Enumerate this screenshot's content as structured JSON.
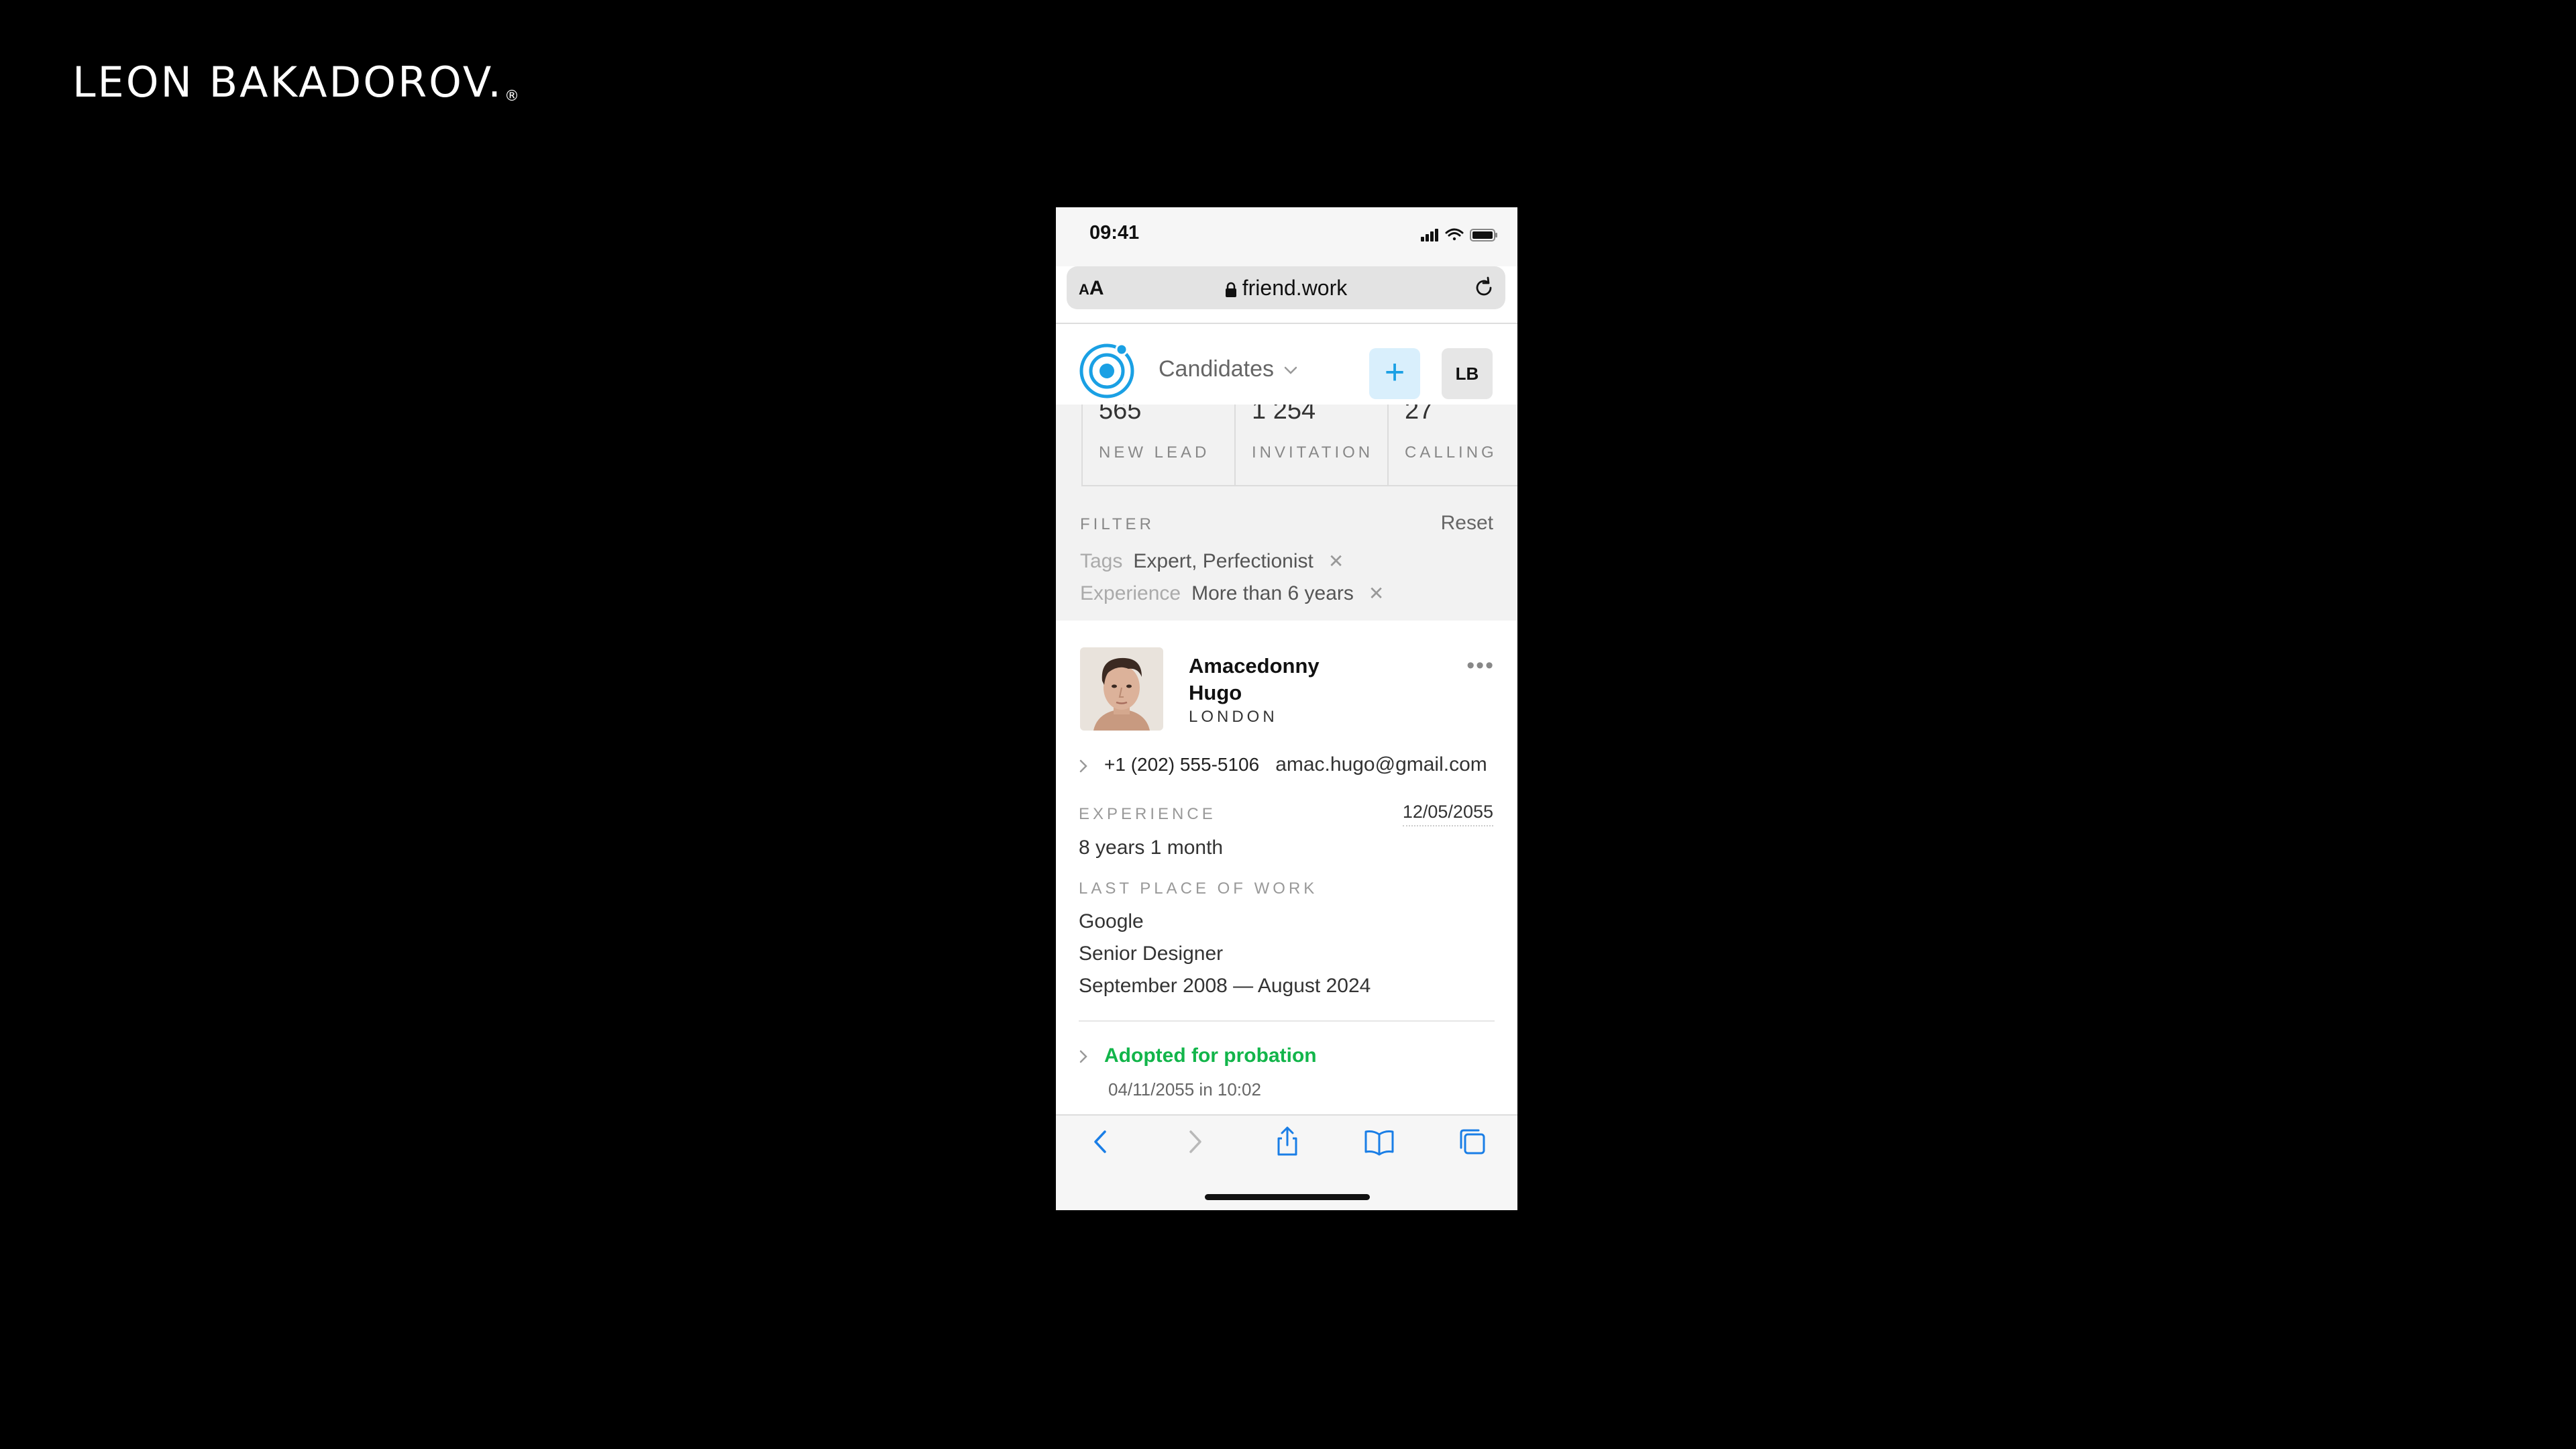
{
  "brand": {
    "name": "LEON BAKADOROV.",
    "mark": "®"
  },
  "status_bar": {
    "time": "09:41"
  },
  "browser": {
    "text_size": "AA",
    "url": "friend.work"
  },
  "app": {
    "section": "Candidates",
    "add_label": "+",
    "user_initials": "LB"
  },
  "stats": [
    {
      "value": "565",
      "label": "NEW LEAD"
    },
    {
      "value": "1 254",
      "label": "INVITATION"
    },
    {
      "value": "27",
      "label": "CALLING"
    }
  ],
  "filter": {
    "title": "FILTER",
    "reset": "Reset",
    "rows": [
      {
        "key": "Tags",
        "value": "Expert, Perfectionist",
        "remove": "✕"
      },
      {
        "key": "Experience",
        "value": "More than 6 years",
        "remove": "✕"
      }
    ]
  },
  "candidate": {
    "first_name": "Amacedonny",
    "last_name": "Hugo",
    "city": "LONDON",
    "more": "•••",
    "phone": "+1 (202) 555-5106",
    "email": "amac.hugo@gmail.com",
    "experience_label": "EXPERIENCE",
    "experience_value": "8 years 1 month",
    "experience_date": "12/05/2055",
    "last_work_label": "LAST PLACE OF WORK",
    "company": "Google",
    "position": "Senior Designer",
    "period": "September 2008 — August 2024",
    "status": "Adopted for probation",
    "status_date": "04/11/2055 in 10:02",
    "status_color": "#12b54a"
  },
  "colors": {
    "accent": "#1aa0e4",
    "accent_bg": "#d9effc",
    "success": "#12b54a"
  }
}
